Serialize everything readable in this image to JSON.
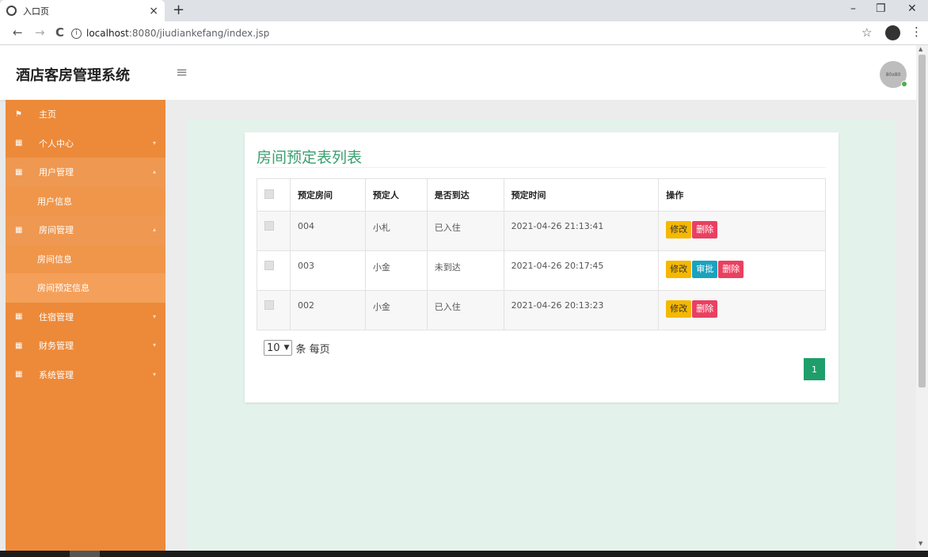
{
  "browser": {
    "tab_title": "入口页",
    "tab_close": "×",
    "new_tab": "+",
    "url_host": "localhost",
    "url_rest": ":8080/jiudiankefang/index.jsp",
    "controls": {
      "minimize": "–",
      "restore": "❐",
      "close": "✕"
    },
    "nav": {
      "back": "←",
      "forward": "→",
      "reload": "C"
    },
    "star": "☆",
    "kebab": "⋮"
  },
  "header": {
    "app_title": "酒店客房管理系统",
    "menu_toggle": "≡",
    "avatar_text": "80x80"
  },
  "sidebar": {
    "items": [
      {
        "label": "主页",
        "icon": "flag-icon",
        "arrow": ""
      },
      {
        "label": "个人中心",
        "icon": "grid-icon",
        "arrow": "▾"
      },
      {
        "label": "用户管理",
        "icon": "grid-icon",
        "arrow": "▴"
      },
      {
        "label": "用户信息"
      },
      {
        "label": "房间管理",
        "icon": "grid-icon",
        "arrow": "▴"
      },
      {
        "label": "房间信息"
      },
      {
        "label": "房间预定信息"
      },
      {
        "label": "住宿管理",
        "icon": "grid-icon",
        "arrow": "▾"
      },
      {
        "label": "财务管理",
        "icon": "grid-icon",
        "arrow": "▾"
      },
      {
        "label": "系统管理",
        "icon": "grid-icon",
        "arrow": "▾"
      }
    ],
    "icon_glyphs": {
      "flag": "⚑",
      "grid": "▦"
    }
  },
  "main": {
    "panel_title": "房间预定表列表",
    "table": {
      "headers": [
        "预定房间",
        "预定人",
        "是否到达",
        "预定时间",
        "操作"
      ],
      "rows": [
        {
          "room": "004",
          "person": "小札",
          "status": "已入住",
          "time": "2021-04-26 21:13:41"
        },
        {
          "room": "003",
          "person": "小金",
          "status": "未到达",
          "time": "2021-04-26 20:17:45"
        },
        {
          "room": "002",
          "person": "小金",
          "status": "已入住",
          "time": "2021-04-26 20:13:23"
        }
      ]
    },
    "buttons": {
      "edit": "修改",
      "approve": "审批",
      "delete": "删除"
    },
    "pager": {
      "page_size": "10",
      "per_page_label": "条 每页",
      "current_page": "1"
    }
  },
  "colors": {
    "sidebar": "#ec8a3a",
    "title_green": "#3a9f6f",
    "edit_button": "#f5b800",
    "approve_button": "#1aa3be",
    "delete_button": "#ea4060",
    "page_button": "#1e9e6a"
  }
}
